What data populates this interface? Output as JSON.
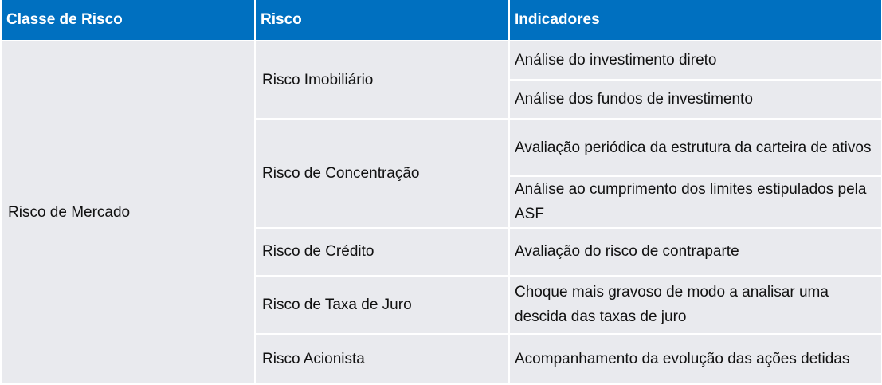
{
  "header": {
    "col1": "Classe de Risco",
    "col2": "Risco",
    "col3": "Indicadores"
  },
  "risk_class": "Risco de Mercado",
  "risks": [
    {
      "name": "Risco Imobiliário",
      "indicators": [
        "Análise do investimento direto",
        "Análise dos fundos de investimento"
      ]
    },
    {
      "name": "Risco de Concentração",
      "indicators": [
        "Avaliação periódica da estrutura da carteira de ativos",
        "Análise ao cumprimento dos limites estipulados pela ASF"
      ]
    },
    {
      "name": "Risco de Crédito",
      "indicators": [
        "Avaliação do risco de contraparte"
      ]
    },
    {
      "name": "Risco de Taxa de Juro",
      "indicators": [
        "Choque mais gravoso de modo a analisar uma descida das taxas de juro"
      ]
    },
    {
      "name": "Risco Acionista",
      "indicators": [
        "Acompanhamento da evolução das ações detidas"
      ]
    }
  ],
  "colors": {
    "header_bg": "#0070c0",
    "header_text": "#ffffff",
    "cell_bg": "#e9eaee"
  }
}
